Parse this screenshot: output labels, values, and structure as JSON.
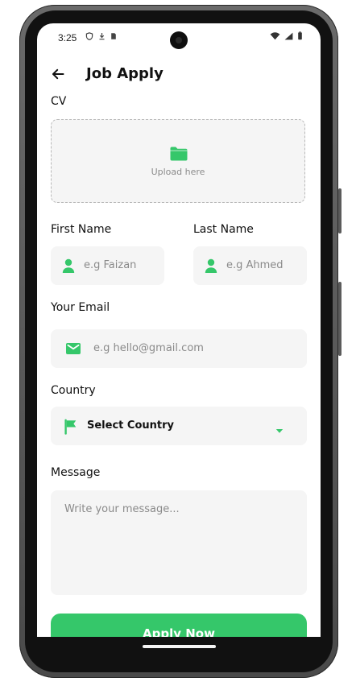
{
  "status_bar": {
    "time": "3:25"
  },
  "header": {
    "title": "Job Apply"
  },
  "cv": {
    "label": "CV",
    "upload_text": "Upload here"
  },
  "form": {
    "first_name": {
      "label": "First Name",
      "placeholder": "e.g Faizan"
    },
    "last_name": {
      "label": "Last Name",
      "placeholder": "e.g Ahmed"
    },
    "email": {
      "label": "Your Email",
      "placeholder": "e.g hello@gmail.com"
    },
    "country": {
      "label": "Country",
      "value": "Select Country"
    },
    "message": {
      "label": "Message",
      "placeholder": "Write your message..."
    }
  },
  "actions": {
    "apply_label": "Apply Now"
  },
  "colors": {
    "accent": "#35c76a",
    "field_bg": "#f5f5f5",
    "text": "#111111",
    "placeholder": "#8a8a8a"
  }
}
